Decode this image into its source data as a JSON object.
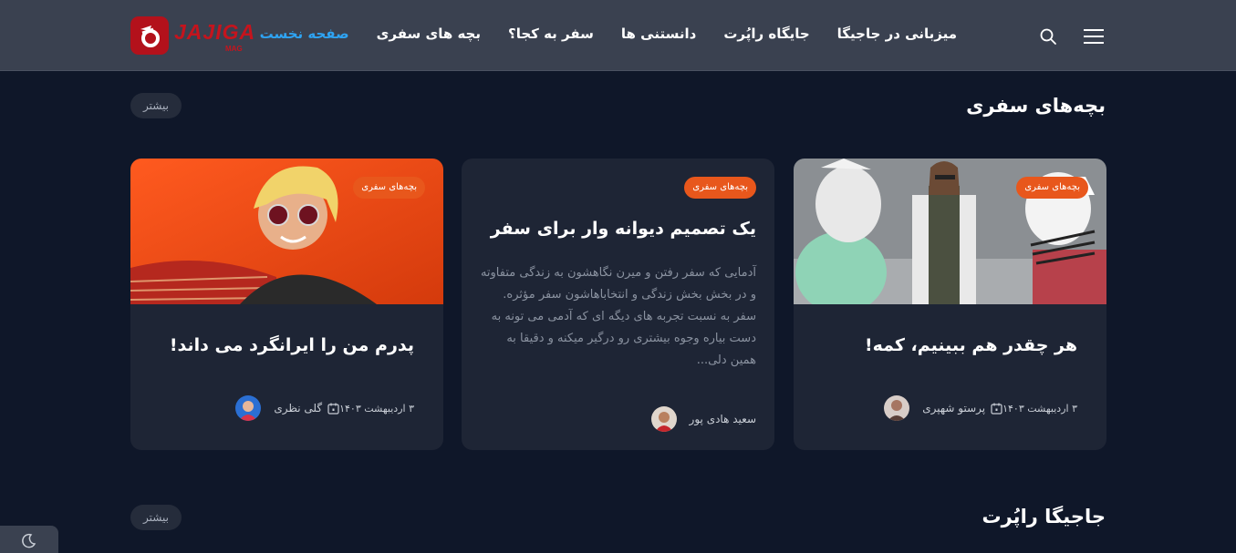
{
  "header": {
    "logo_text": "JAJIGA",
    "logo_sub": "MAG",
    "nav": [
      {
        "label": "صفحه نخست",
        "active": true
      },
      {
        "label": "بچه های سفری",
        "active": false
      },
      {
        "label": "سفر به کجا؟",
        "active": false
      },
      {
        "label": "دانستنی ها",
        "active": false
      },
      {
        "label": "جایگاه راپُرت",
        "active": false
      },
      {
        "label": "میزبانی در جاجیگا",
        "active": false
      }
    ]
  },
  "sections": [
    {
      "title": "بچه‌های سفری",
      "more_label": "بیشتر"
    },
    {
      "title": "جاجیگا راپُرت",
      "more_label": "بیشتر"
    }
  ],
  "cards": [
    {
      "badge": "بچه‌های سفری",
      "title": "هر چقدر هم ببینیم، کمه!",
      "author": "پرستو شهپری",
      "date": "۳ اردیبهشت ۱۴۰۳"
    },
    {
      "badge": "بچه‌های سفری",
      "title": "یک تصمیم دیوانه وار برای سفر",
      "excerpt": "آدمایی که سفر رفتن و میرن نگاهشون به زندگی متفاوته و در بخش بخش زندگی و انتخاباهاشون سفر مؤثره. سفر به نسبت تجربه های دیگه ای که آدمی می تونه به دست بیاره وجوه بیشتری رو درگیر میکنه و دقیقا به همین دلی...",
      "author": "سعید هادی پور"
    },
    {
      "badge": "بچه‌های سفری",
      "title": "پدرم من را ایرانگرد می داند!",
      "author": "گلی نظری",
      "date": "۳ اردیبهشت ۱۴۰۳"
    }
  ],
  "colors": {
    "background": "#0f1729",
    "header": "#3a4150",
    "card": "#1e2535",
    "accent": "#2ea3f2",
    "badge": "#e8571c",
    "brand": "#c5141d"
  }
}
